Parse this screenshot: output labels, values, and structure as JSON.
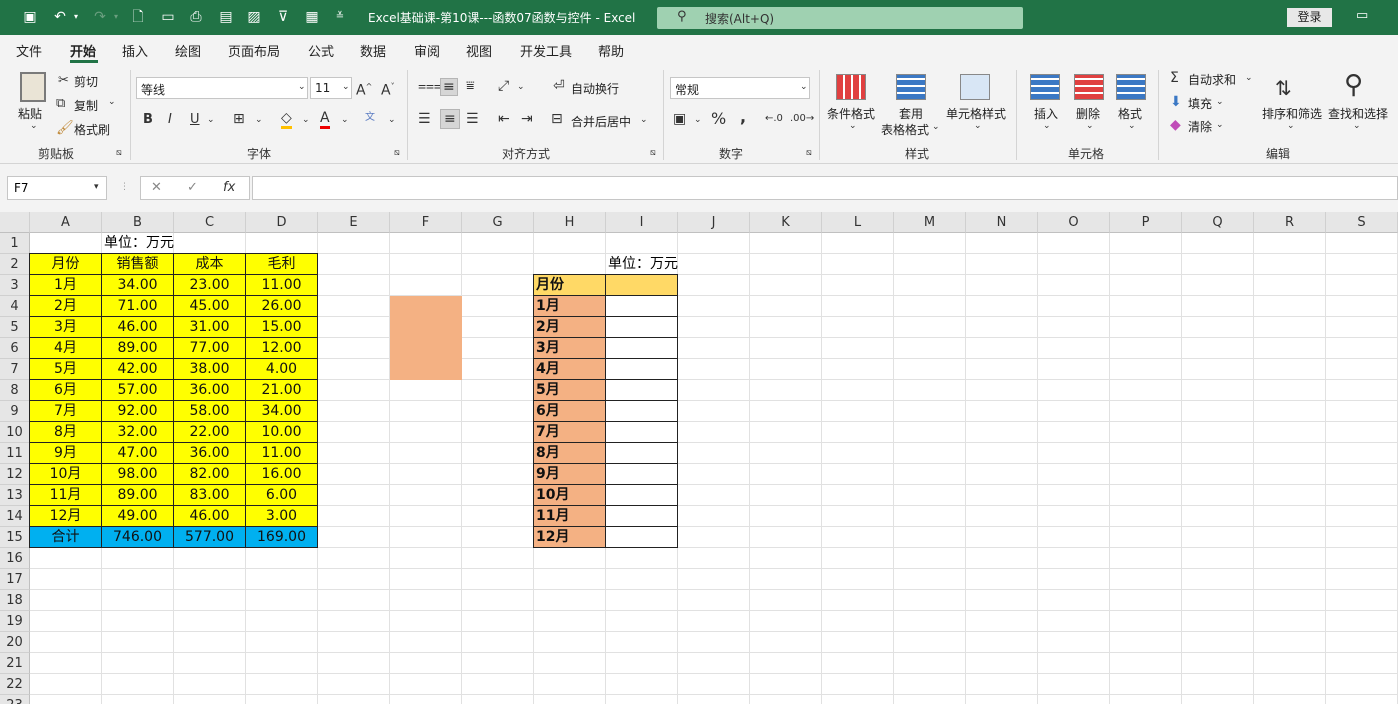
{
  "titlebar": {
    "title": "Excel基础课-第10课---函数07函数与控件  -  Excel",
    "search_placeholder": "搜索(Alt+Q)",
    "login": "登录"
  },
  "menu": [
    "文件",
    "开始",
    "插入",
    "绘图",
    "页面布局",
    "公式",
    "数据",
    "审阅",
    "视图",
    "开发工具",
    "帮助"
  ],
  "ribbon": {
    "clipboard": {
      "paste": "粘贴",
      "cut": "剪切",
      "copy": "复制",
      "format_painter": "格式刷",
      "label": "剪贴板"
    },
    "font": {
      "name": "等线",
      "size": "11",
      "label": "字体",
      "bold": "B",
      "italic": "I",
      "underline": "U",
      "grow": "A^",
      "shrink": "A˅"
    },
    "align": {
      "wrap": "自动换行",
      "merge": "合并后居中",
      "label": "对齐方式"
    },
    "number": {
      "format": "常规",
      "label": "数字",
      "percent": "%",
      "comma": ","
    },
    "styles": {
      "cond": "条件格式",
      "table1": "套用",
      "table2": "表格格式",
      "cell": "单元格样式",
      "label": "样式"
    },
    "cells": {
      "insert": "插入",
      "delete": "删除",
      "format": "格式",
      "label": "单元格"
    },
    "editing": {
      "autosum": "自动求和",
      "fill": "填充",
      "clear": "清除",
      "sort": "排序和筛选",
      "find": "查找和选择",
      "label": "编辑"
    }
  },
  "formula_bar": {
    "name_box": "F7",
    "fx": "fx"
  },
  "sheet": {
    "columns": [
      "A",
      "B",
      "C",
      "D",
      "E",
      "F",
      "G",
      "H",
      "I",
      "J",
      "K",
      "L",
      "M",
      "N",
      "O",
      "P",
      "Q",
      "R",
      "S"
    ],
    "rows": [
      "1",
      "2",
      "3",
      "4",
      "5",
      "6",
      "7",
      "8",
      "9",
      "10",
      "11",
      "12",
      "13",
      "14",
      "15",
      "16",
      "17",
      "18",
      "19",
      "20",
      "21",
      "22",
      "23"
    ],
    "unit_label": "单位：万元",
    "headers": [
      "月份",
      "销售额",
      "成本",
      "毛利"
    ],
    "data": [
      [
        "1月",
        "34.00",
        "23.00",
        "11.00"
      ],
      [
        "2月",
        "71.00",
        "45.00",
        "26.00"
      ],
      [
        "3月",
        "46.00",
        "31.00",
        "15.00"
      ],
      [
        "4月",
        "89.00",
        "77.00",
        "12.00"
      ],
      [
        "5月",
        "42.00",
        "38.00",
        "4.00"
      ],
      [
        "6月",
        "57.00",
        "36.00",
        "21.00"
      ],
      [
        "7月",
        "92.00",
        "58.00",
        "34.00"
      ],
      [
        "8月",
        "32.00",
        "22.00",
        "10.00"
      ],
      [
        "9月",
        "47.00",
        "36.00",
        "11.00"
      ],
      [
        "10月",
        "98.00",
        "82.00",
        "16.00"
      ],
      [
        "11月",
        "89.00",
        "83.00",
        "6.00"
      ],
      [
        "12月",
        "49.00",
        "46.00",
        "3.00"
      ]
    ],
    "total": [
      "合计",
      "746.00",
      "577.00",
      "169.00"
    ],
    "right_unit": "单位：万元",
    "right_header": "月份",
    "right_months": [
      "1月",
      "2月",
      "3月",
      "4月",
      "5月",
      "6月",
      "7月",
      "8月",
      "9月",
      "10月",
      "11月",
      "12月"
    ]
  }
}
